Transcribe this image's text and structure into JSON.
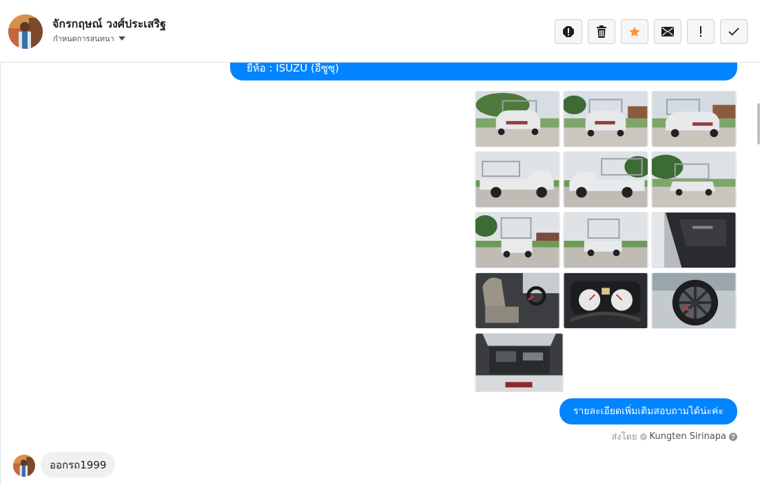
{
  "header": {
    "contact_name": "จักรกฤษณ์ วงศ์ประเสริฐ",
    "conversation_menu_label": "กำหนดการสนทนา",
    "actions": [
      {
        "name": "report-spam-button",
        "icon": "exclamation-circle-icon"
      },
      {
        "name": "delete-button",
        "icon": "trash-icon"
      },
      {
        "name": "star-button",
        "icon": "star-icon",
        "color": "#f7923b"
      },
      {
        "name": "mark-unread-button",
        "icon": "envelope-icon"
      },
      {
        "name": "follow-up-button",
        "icon": "exclamation-icon"
      },
      {
        "name": "mark-done-button",
        "icon": "check-icon"
      }
    ]
  },
  "messages": {
    "top_bubble_text": "ยี่ห้อ : ISUZU (อีซูซุ)",
    "photos_count": 13,
    "details_bubble_text": "รายละเอียดเพิ่มเติมสอบถามได้น่ะค่ะ",
    "sent_by_label": "ส่งโดย",
    "sent_by_name": "Kungten Sirinapa",
    "incoming_text": "ออกรถ1999"
  },
  "colors": {
    "accent": "#0084ff",
    "incoming_bubble": "#f1f0f0",
    "star": "#f7923b"
  }
}
